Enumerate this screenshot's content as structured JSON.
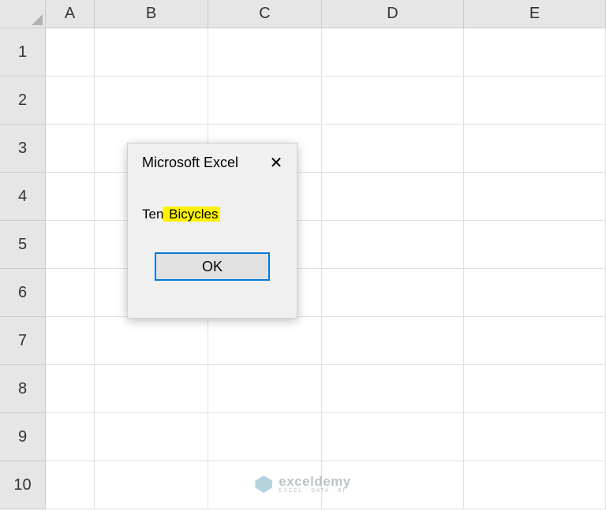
{
  "columns": [
    "A",
    "B",
    "C",
    "D",
    "E"
  ],
  "rows": [
    "1",
    "2",
    "3",
    "4",
    "5",
    "6",
    "7",
    "8",
    "9",
    "10"
  ],
  "dialog": {
    "title": "Microsoft Excel",
    "message_prefix": "Ten",
    "message_highlight": " Bicycles",
    "ok_label": "OK"
  },
  "watermark": {
    "main": "exceldemy",
    "sub": "EXCEL · DATA · BI"
  }
}
